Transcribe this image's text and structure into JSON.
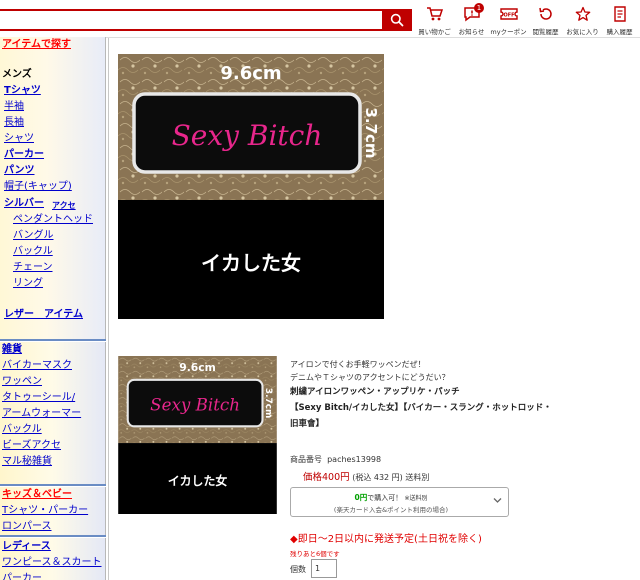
{
  "header": {
    "search": {
      "value": "",
      "placeholder": ""
    },
    "icons": [
      {
        "name": "cart",
        "label": "買い物かご"
      },
      {
        "name": "notifications",
        "label": "お知らせ",
        "badge": "1"
      },
      {
        "name": "coupon",
        "label": "myクーポン"
      },
      {
        "name": "history",
        "label": "閲覧履歴"
      },
      {
        "name": "favorites",
        "label": "お気に入り"
      },
      {
        "name": "purchase-history",
        "label": "購入履歴"
      }
    ],
    "accent_color": "#bf0000"
  },
  "sidebar": {
    "title": "アイテムで探す",
    "mens": {
      "heading": "メンズ",
      "tshirt": "Tシャツ",
      "tshirt_items": [
        "半袖",
        "長袖"
      ],
      "shirt": "シャツ",
      "parka": "パーカー",
      "pants": "パンツ",
      "cap": "帽子(キャップ)",
      "silver": "シルバー",
      "silver_sub": "アクセ",
      "silver_items": [
        "ペンダントヘッド",
        "バングル",
        "バックル",
        "チェーン",
        "リング"
      ],
      "leather": "レザー　アイテム"
    },
    "misc": {
      "heading": "雑貨",
      "items": [
        "バイカーマスク",
        "ワッペン",
        "タトゥーシール/",
        "アームウォーマー",
        "バックル",
        "ビーズアクセ",
        "マル秘雑貨"
      ]
    },
    "kids": {
      "heading": "キッズ＆ベビー",
      "items": [
        "Tシャツ・パーカー",
        "ロンパース"
      ]
    },
    "ladies": {
      "heading": "レディース",
      "items": [
        "ワンピース＆スカート",
        "パーカー"
      ]
    }
  },
  "product_image": {
    "width_label": "9.6cm",
    "height_label": "3.7cm",
    "patch_text": "Sexy Bitch",
    "caption": "イカした女"
  },
  "product": {
    "tagline1": "アイロンで付くお手軽ワッペンだぜ！",
    "tagline2": "デニムやＴシャツのアクセントにどうだい？",
    "title_line1": "刺繍アイロンワッペン・アップリケ・パッチ",
    "title_line2": "【Sexy Bitch/イカした女】【バイカー・スラング・ホットロッド・",
    "title_line3": "旧車會】",
    "code_label": "商品番号",
    "code": "paches13998",
    "price_label": "価格",
    "price": "400円",
    "tax_note": "(税込 432 円)",
    "shipping": "送料別",
    "coupon_amount": "0円",
    "coupon_text": "で購入可！",
    "coupon_tag": "※送料別",
    "coupon_note": "(楽天カード入会&ポイント利用の場合)",
    "ship_note": "◆即日〜2日以内に発送予定(土日祝を除く)",
    "stock_note": "残りあと6個です",
    "qty_label": "個数",
    "qty_value": "1"
  }
}
